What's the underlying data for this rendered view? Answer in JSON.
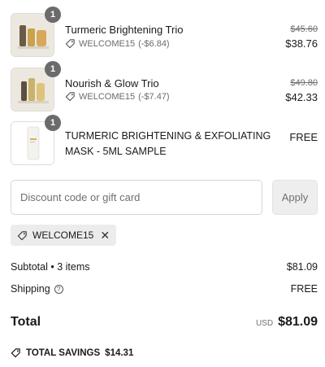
{
  "items": [
    {
      "name": "Turmeric Brightening Trio",
      "qty": "1",
      "discount_code": "WELCOME15",
      "discount_amount": "(-$6.84)",
      "original_price": "$45.60",
      "price": "$38.76"
    },
    {
      "name": "Nourish & Glow Trio",
      "qty": "1",
      "discount_code": "WELCOME15",
      "discount_amount": "(-$7.47)",
      "original_price": "$49.80",
      "price": "$42.33"
    },
    {
      "name": "TURMERIC BRIGHTENING & EXFOLIATING MASK - 5ML SAMPLE",
      "qty": "1",
      "price": "FREE"
    }
  ],
  "discount_form": {
    "placeholder": "Discount code or gift card",
    "value": "",
    "apply_label": "Apply"
  },
  "applied_code": {
    "code": "WELCOME15",
    "remove_glyph": "✕"
  },
  "summary": {
    "subtotal_label": "Subtotal • 3 items",
    "subtotal_value": "$81.09",
    "shipping_label": "Shipping",
    "shipping_value": "FREE",
    "total_label": "Total",
    "currency": "USD",
    "total_value": "$81.09",
    "savings_label": "TOTAL SAVINGS",
    "savings_value": "$14.31"
  },
  "icons": {
    "tag": "tag-icon",
    "info": "info-icon",
    "close": "close-icon"
  },
  "colors": {
    "badge": "#6b6b6b",
    "muted_text": "#707070",
    "chip_bg": "#ececec",
    "apply_bg": "#eeeeee"
  }
}
